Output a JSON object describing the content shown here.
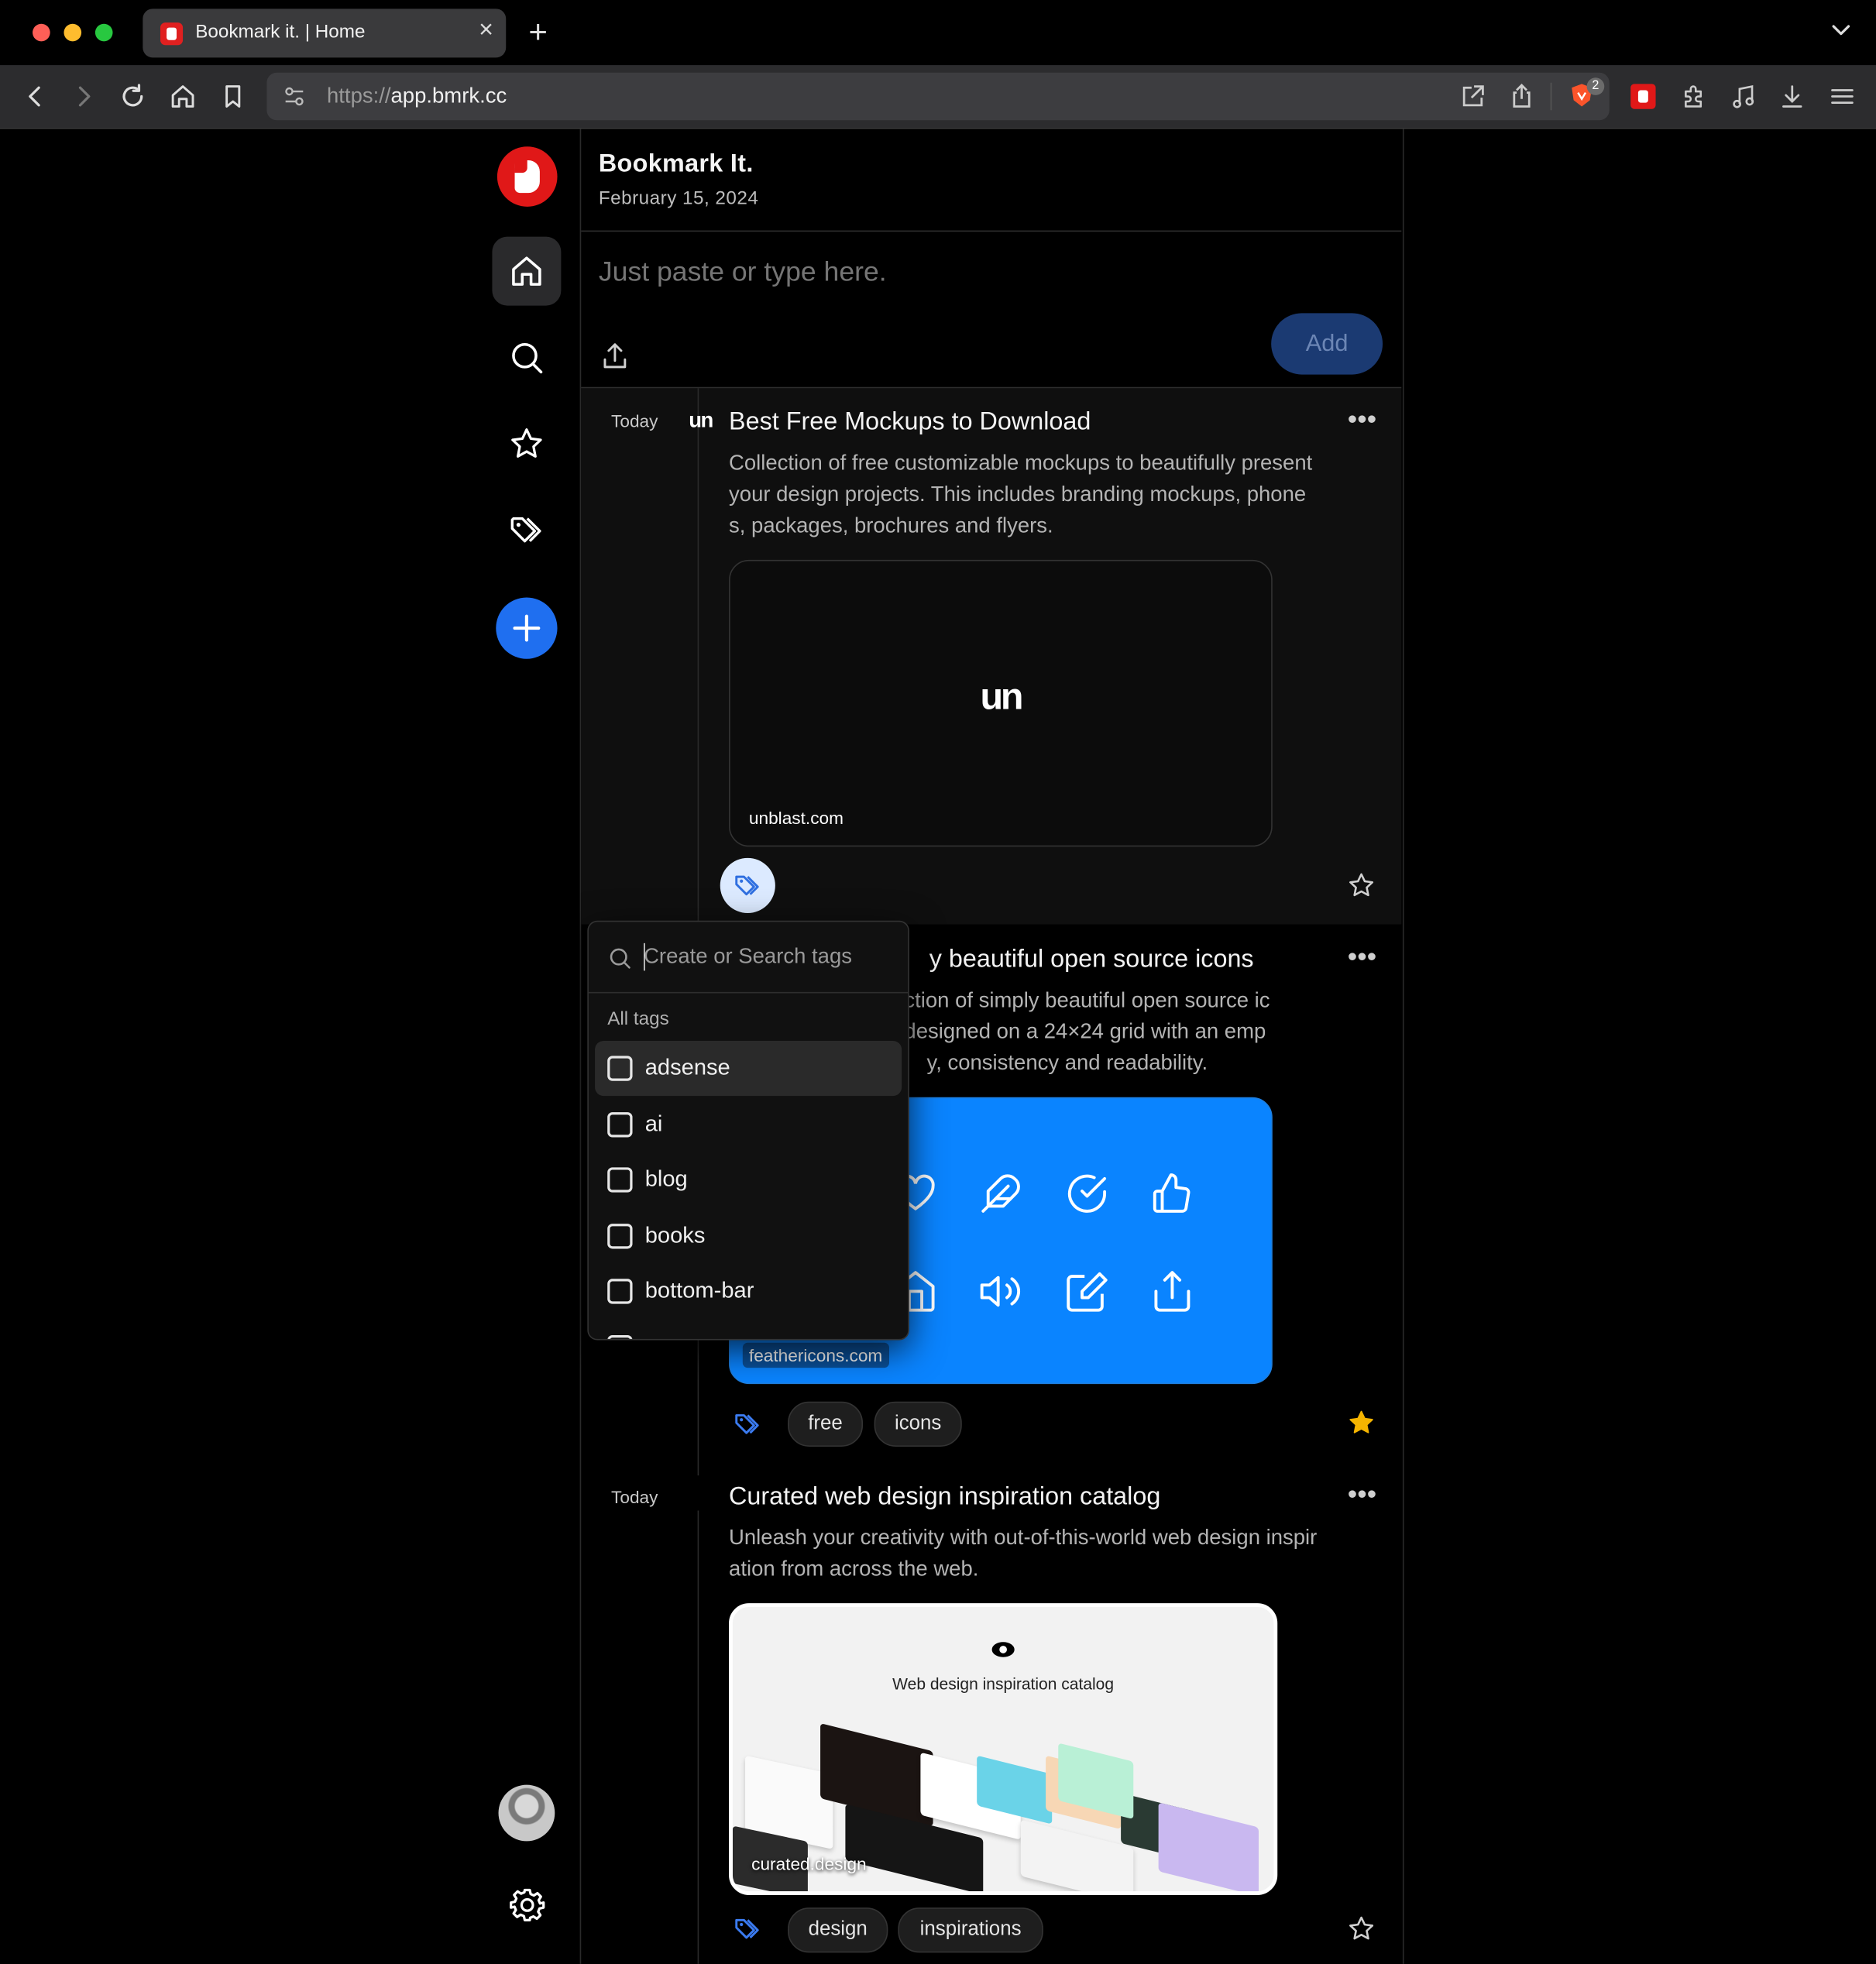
{
  "browser": {
    "tab_title": "Bookmark it. | Home",
    "tab_close": "×",
    "new_tab": "+",
    "url_scheme": "https://",
    "url_host": "app.bmrk.cc",
    "brave_badge": "2"
  },
  "header": {
    "title": "Bookmark It.",
    "date": "February 15, 2024"
  },
  "compose": {
    "placeholder": "Just paste or type here.",
    "add_label": "Add"
  },
  "bookmarks": [
    {
      "day": "Today",
      "source_logo": "un",
      "title": "Best Free Mockups to Download",
      "description": "Collection of free customizable mockups to beautifully present your design projects. This includes branding mockups, phones, packages, brochures and flyers.",
      "preview_text": "un",
      "site": "unblast.com",
      "favorite": false,
      "tags": []
    },
    {
      "title_visible": "y beautiful open source icons",
      "description_lines": [
        "ction of simply beautiful open source ic",
        "designed on a 24×24 grid with an emp",
        "y, consistency and readability."
      ],
      "site": "feathericons.com",
      "favorite": true,
      "tags": [
        "free",
        "icons"
      ]
    },
    {
      "day": "Today",
      "title": "Curated web design inspiration catalog",
      "description": "Unleash your creativity with out-of-this-world web design inspiration from across the web.",
      "preview_title": "Web design inspiration catalog",
      "site": "curated.design",
      "favorite": false,
      "tags": [
        "design",
        "inspirations"
      ]
    }
  ],
  "tag_menu": {
    "search_placeholder": "Create or Search tags",
    "section_label": "All tags",
    "items": [
      "adsense",
      "ai",
      "blog",
      "books",
      "bottom-bar"
    ]
  },
  "colors": {
    "accent": "#1f6ff0",
    "brand": "#e01818",
    "favorite_star": "#f5b400",
    "feather_bg": "#0a84ff"
  }
}
